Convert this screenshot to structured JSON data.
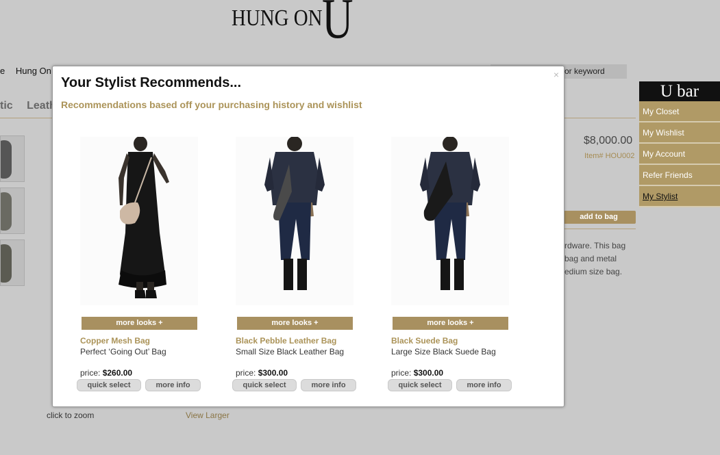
{
  "logo": {
    "text": "HUNG ON",
    "letter": "U"
  },
  "breadcrumb": [
    "e",
    "Hung On U"
  ],
  "search": {
    "text": "or keyword"
  },
  "categories": [
    "tic",
    "Leath"
  ],
  "product_page": {
    "price": "$8,000.00",
    "item_number": "Item# HOU002",
    "add_to_bag": "add to bag",
    "description_lines": [
      "rdware. This bag",
      "bag and metal",
      "edium size bag."
    ],
    "click_to_zoom": "click to zoom",
    "view_larger": "View Larger"
  },
  "ubar": {
    "title": "U bar",
    "items": [
      "My Closet",
      "My Wishlist",
      "My Account",
      "Refer Friends",
      "My Stylist"
    ]
  },
  "modal": {
    "close": "×",
    "title": "Your Stylist Recommends...",
    "subtitle": "Recommendations based off your purchasing history and wishlist",
    "more_looks": "more looks +",
    "price_label": "price:",
    "quick_select": "quick select",
    "more_info": "more info",
    "products": [
      {
        "name": "Copper Mesh Bag",
        "tagline": "Perfect ‘Going Out’ Bag",
        "price": "$260.00"
      },
      {
        "name": "Black Pebble Leather Bag",
        "tagline": "Small Size Black Leather Bag",
        "price": "$300.00"
      },
      {
        "name": "Black Suede Bag",
        "tagline": "Large Size Black Suede Bag",
        "price": "$300.00"
      }
    ]
  },
  "colors": {
    "gold": "#a89060",
    "gold_text": "#ab9358",
    "backdrop": "#c9c9c9"
  }
}
